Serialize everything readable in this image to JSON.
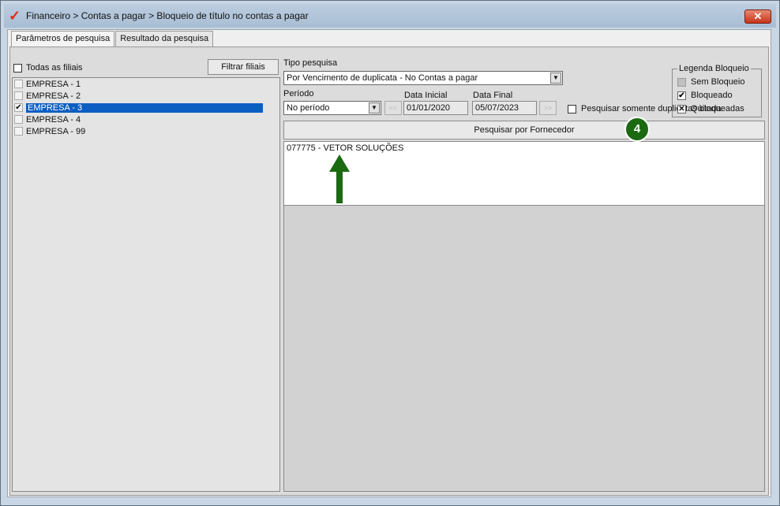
{
  "window": {
    "title": "Financeiro > Contas a pagar > Bloqueio de título no contas a pagar",
    "close_label": "✕"
  },
  "tabs": [
    {
      "label": "Parâmetros de pesquisa"
    },
    {
      "label": "Resultado da pesquisa"
    }
  ],
  "filiais": {
    "todas_label": "Todas as filiais",
    "filtrar_label": "Filtrar filiais",
    "items": [
      {
        "label": "EMPRESA - 1",
        "checked": false
      },
      {
        "label": "EMPRESA - 2",
        "checked": false
      },
      {
        "label": "EMPRESA - 3",
        "checked": true
      },
      {
        "label": "EMPRESA - 4",
        "checked": false
      },
      {
        "label": "EMPRESA - 99",
        "checked": false
      }
    ]
  },
  "search": {
    "tipo_label": "Tipo pesquisa",
    "tipo_value": "Por Vencimento de duplicata - No Contas a pagar",
    "periodo_label": "Período",
    "periodo_value": "No período",
    "data_inicial_label": "Data Inicial",
    "data_inicial_value": "01/01/2020",
    "data_final_label": "Data Final",
    "data_final_value": "05/07/2023",
    "prev_label": "<<",
    "next_label": ">>",
    "somente_bloqueadas_label": "Pesquisar somente duplicatas bloqueadas",
    "fornecedor_button": "Pesquisar por Fornecedor"
  },
  "legend": {
    "title": "Legenda Bloqueio",
    "items": [
      {
        "label": "Sem Bloqueio",
        "mark": ""
      },
      {
        "label": "Bloqueado",
        "mark": "✔"
      },
      {
        "label": "Quitada",
        "mark": "✕"
      }
    ]
  },
  "results": {
    "items": [
      "077775 - VETOR SOLUÇÕES"
    ]
  },
  "annotation": {
    "step_number": "4",
    "arrow_color": "#1b6a12"
  }
}
